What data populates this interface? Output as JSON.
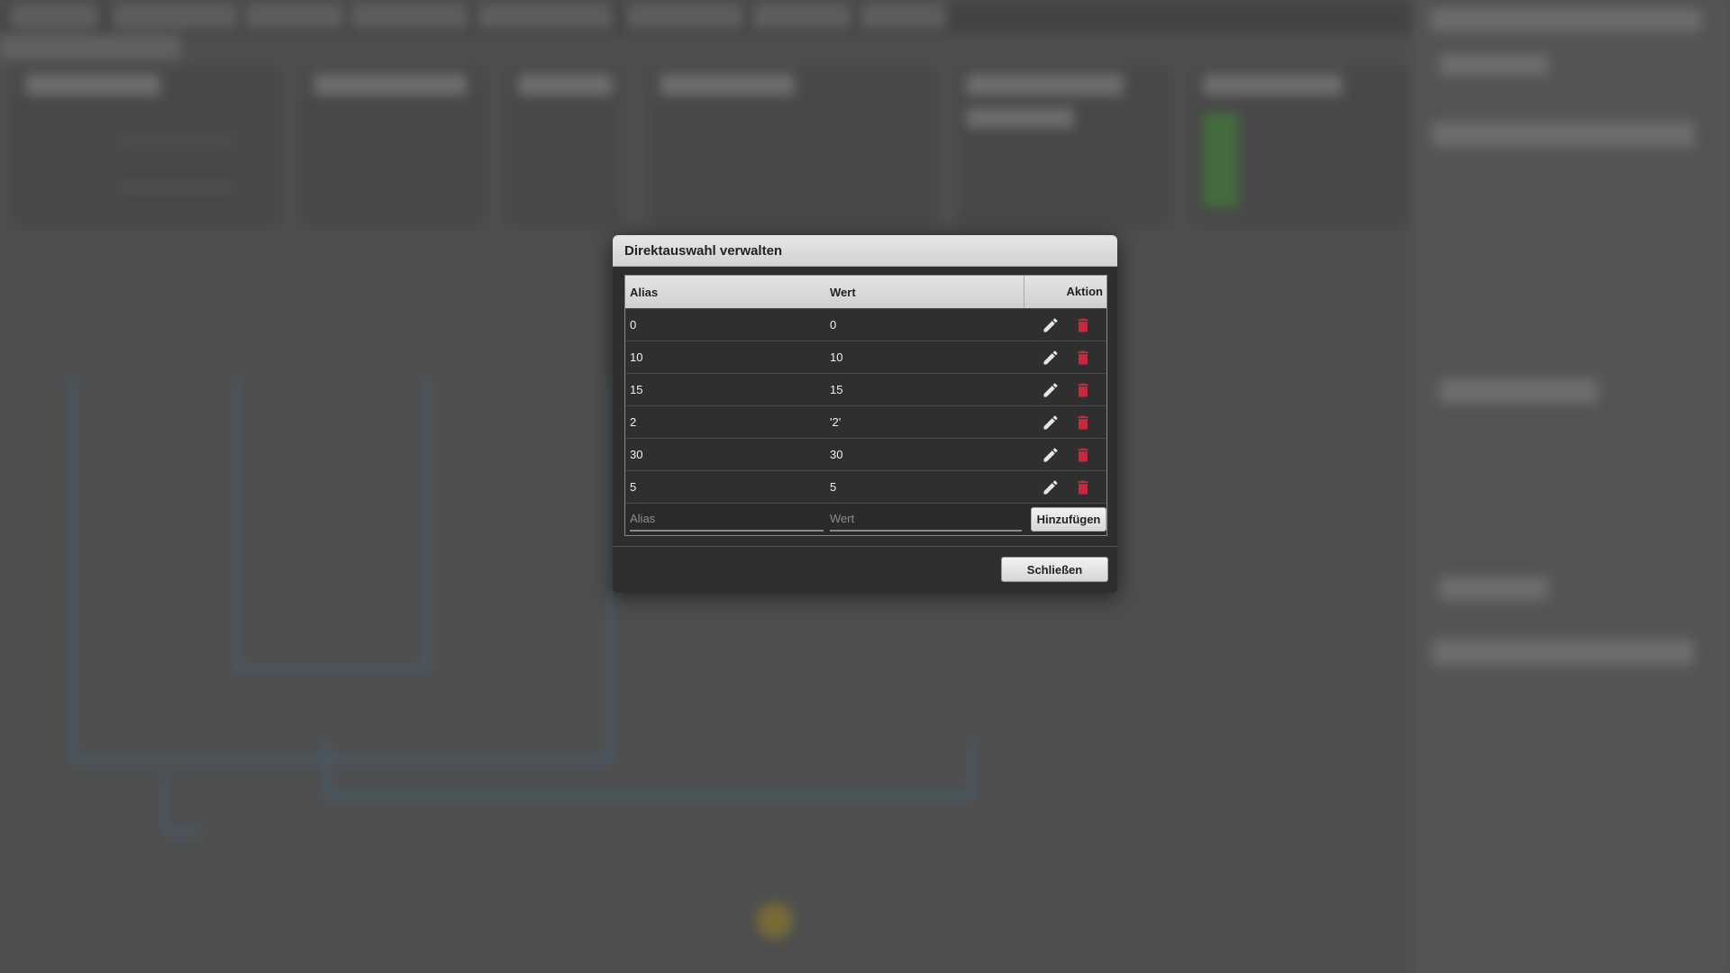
{
  "colors": {
    "delete_icon": "#c8283a",
    "edit_icon": "#e6e6e6",
    "dialog_bg": "#2e2e2e",
    "header_bg": "#dcdcdc"
  },
  "dialog": {
    "title": "Direktauswahl verwalten",
    "columns": {
      "alias": "Alias",
      "wert": "Wert",
      "aktion": "Aktion"
    },
    "rows": [
      {
        "alias": "0",
        "wert": "0"
      },
      {
        "alias": "10",
        "wert": "10"
      },
      {
        "alias": "15",
        "wert": "15"
      },
      {
        "alias": "2",
        "wert": "'2'"
      },
      {
        "alias": "30",
        "wert": "30"
      },
      {
        "alias": "5",
        "wert": "5"
      }
    ],
    "new_entry": {
      "alias_placeholder": "Alias",
      "wert_placeholder": "Wert",
      "add_label": "Hinzufügen"
    },
    "close_label": "Schließen",
    "icons": {
      "edit": "pencil-icon",
      "delete": "trash-icon"
    }
  }
}
